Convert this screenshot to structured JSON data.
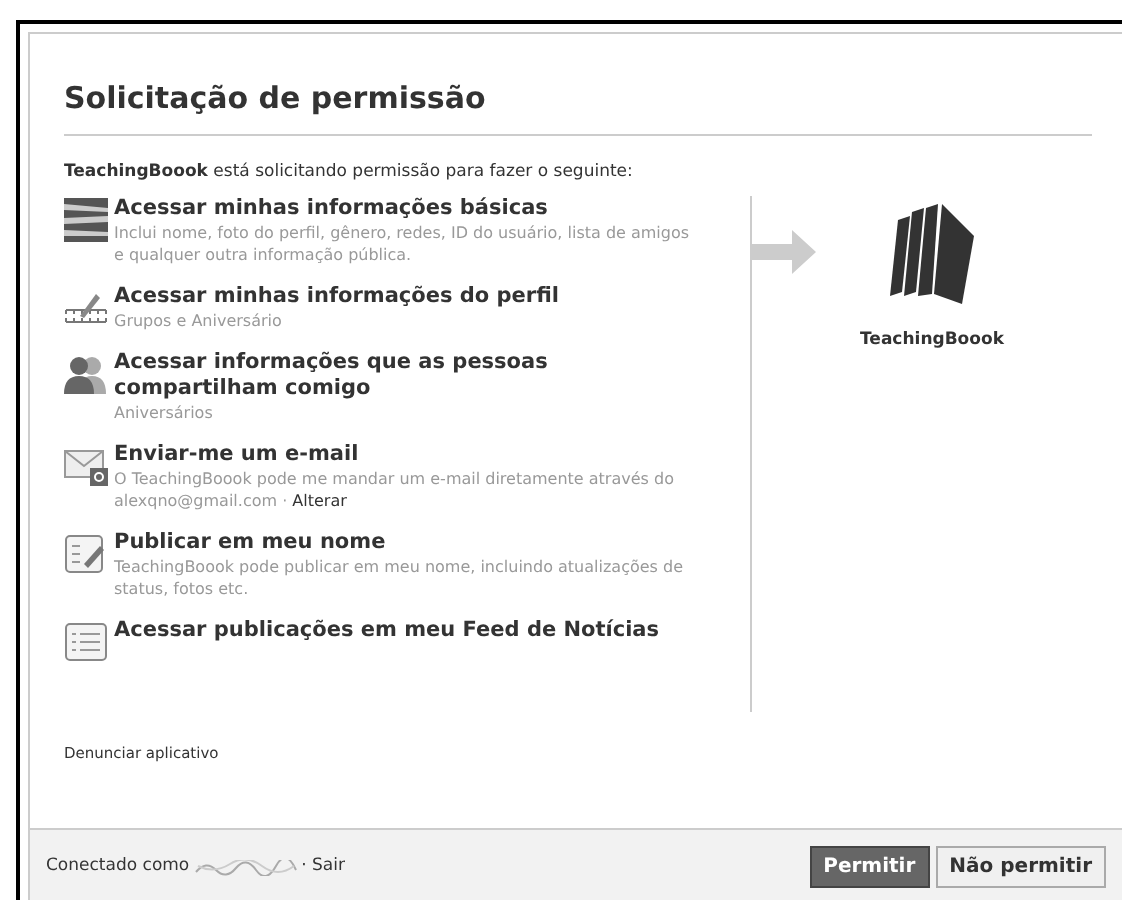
{
  "dialog": {
    "title": "Solicitação de permissão",
    "intro": "**TeachingBoook** está solicitando permissão para fazer o seguinte:",
    "permissions": [
      {
        "kind": "basic",
        "title": "Acessar minhas informações básicas",
        "description": "Inclui nome, foto do perfil, gênero, redes, ID do usuário, lista de amigos e qualquer outra informação pública."
      },
      {
        "kind": "profile",
        "title": "Acessar minhas informações do perfil",
        "description": "Grupos e Aniversário"
      },
      {
        "kind": "people",
        "title": "Acessar informações que as pessoas compartilham comigo",
        "description": "Aniversários"
      },
      {
        "kind": "email",
        "title": "Enviar-me um e-mail",
        "description": "O TeachingBoook pode me mandar um e-mail diretamente através do alexqno@gmail.com ·",
        "link": "Alterar"
      },
      {
        "kind": "publish",
        "title": "Publicar em meu nome",
        "description": "TeachingBoook pode publicar em meu nome, incluindo atualizações de status, fotos etc."
      },
      {
        "kind": "feed",
        "title": "Acessar publicações em meu Feed de Notícias"
      }
    ],
    "app_name": "TeachingBoook",
    "report_link": "Denunciar aplicativo",
    "footer": {
      "connected_label": "Conectado como",
      "logout_link": "· Sair"
    },
    "buttons": [
      {
        "label": "Permitir",
        "kind": "primary"
      },
      {
        "label": "Não permitir",
        "kind": "secondary"
      }
    ]
  }
}
